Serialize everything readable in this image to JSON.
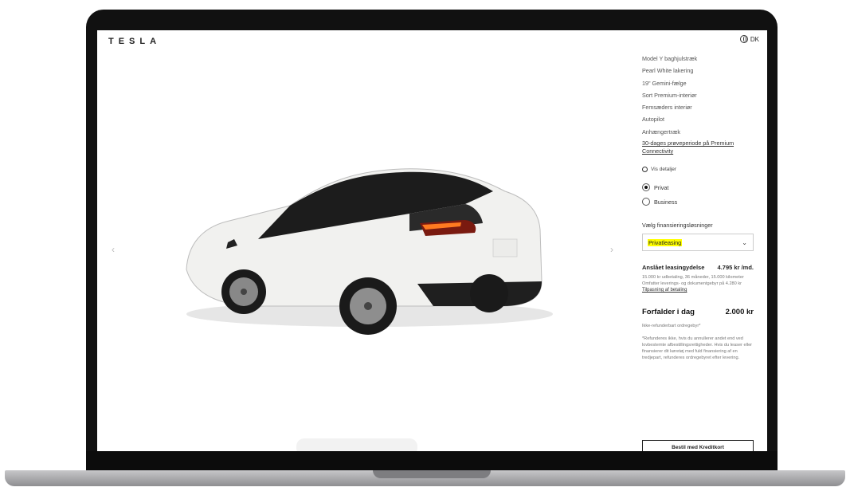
{
  "header": {
    "logo": "TESLA",
    "region": "DK"
  },
  "summary": {
    "features": [
      "Model Y baghjulstræk",
      "Pearl White lakering",
      "19\" Gemini-fælge",
      "Sort Premium-interiør",
      "Femsæders interiør",
      "Autopilot",
      "Anhængertræk"
    ],
    "connectivity_link": "30-dages prøveperiode på Premium Connectivity",
    "details_label": "Vis detaljer"
  },
  "customer_type": {
    "options": [
      "Privat",
      "Business"
    ],
    "selected": "Privat"
  },
  "financing": {
    "label": "Vælg finansieringsløsninger",
    "selected": "Privatleasing"
  },
  "lease": {
    "title": "Anslået leasingydelse",
    "amount": "4.795 kr /md.",
    "line1": "15.000 kr udbetaling, 36 måneder, 15.000 kilometer",
    "line2": "Omfatter leverings- og dokumentgebyr på 4.280 kr",
    "link": "Tilpasning af betaling"
  },
  "due_today": {
    "title": "Forfalder i dag",
    "amount": "2.000 kr",
    "note": "Ikke-refunderbart ordregebyr*",
    "fineprint": "*Refunderes ikke, hvis du annullerer andet end ved lovbestemte afbestillingsrettigheder. Hvis du leaser eller finansierer dit køretøj med fuld finansiering af en tredjepart, refunderes ordregebyret efter levering."
  },
  "cta_label": "Bestil med Kreditkort",
  "colors": {
    "highlight": "#ffff00",
    "car_body": "#f1f1ef"
  }
}
